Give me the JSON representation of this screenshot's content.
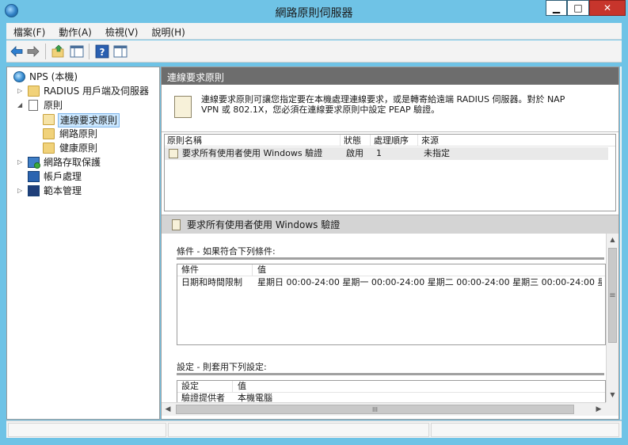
{
  "window": {
    "title": "網路原則伺服器",
    "min_label": "▁",
    "max_label": "□",
    "close_label": "✕"
  },
  "menu": [
    {
      "label": "檔案(F)"
    },
    {
      "label": "動作(A)"
    },
    {
      "label": "檢視(V)"
    },
    {
      "label": "說明(H)"
    }
  ],
  "toolbar": {
    "icons": [
      "back-arrow-icon",
      "forward-arrow-icon",
      "up-folder-icon",
      "show-hide-tree-icon",
      "help-icon",
      "action-pane-icon"
    ]
  },
  "tree": {
    "root": {
      "label": "NPS (本機)",
      "expanded": true
    },
    "items": [
      {
        "label": "RADIUS 用戶端及伺服器",
        "icon": "folder-icon",
        "expander": "▷"
      },
      {
        "label": "原則",
        "icon": "policy-doc-icon",
        "expander": "◢"
      },
      {
        "label": "連線要求原則",
        "icon": "folder-open-icon",
        "selected": true
      },
      {
        "label": "網路原則",
        "icon": "folder-icon"
      },
      {
        "label": "健康原則",
        "icon": "folder-icon"
      },
      {
        "label": "網路存取保護",
        "icon": "nap-icon",
        "expander": "▷"
      },
      {
        "label": "帳戶處理",
        "icon": "accounting-icon"
      },
      {
        "label": "範本管理",
        "icon": "templates-icon",
        "expander": "▷"
      }
    ]
  },
  "main": {
    "header": "連線要求原則",
    "intro_line1": "連線要求原則可讓您指定要在本機處理連線要求，或是轉寄給遠端 RADIUS 伺服器。對於 NAP",
    "intro_line2": "VPN 或 802.1X，您必須在連線要求原則中設定 PEAP 驗證。",
    "list": {
      "columns": [
        "原則名稱",
        "狀態",
        "處理順序",
        "來源"
      ],
      "rows": [
        {
          "name": "要求所有使用者使用 Windows 驗證",
          "status": "啟用",
          "order": "1",
          "source": "未指定"
        }
      ]
    },
    "details": {
      "title": "要求所有使用者使用 Windows 驗證",
      "conditions_title": "條件 - 如果符合下列條件:",
      "conditions_columns": [
        "條件",
        "值"
      ],
      "conditions_rows": [
        {
          "condition": "日期和時間限制",
          "value": "星期日 00:00-24:00 星期一 00:00-24:00 星期二 00:00-24:00 星期三 00:00-24:00 星..."
        }
      ],
      "settings_title": "設定 - 則套用下列設定:",
      "settings_columns": [
        "設定",
        "值"
      ],
      "settings_partial_row": {
        "setting": "驗證提供者",
        "value": "本機電腦"
      }
    },
    "scrollbars": {
      "v_grip": "≡",
      "h_grip": "III",
      "up": "▲",
      "down": "▼",
      "left": "◀",
      "right": "▶"
    }
  }
}
